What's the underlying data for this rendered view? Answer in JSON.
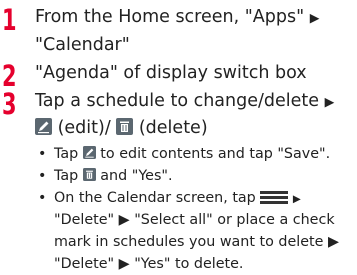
{
  "steps": [
    {
      "number": "1",
      "line1": "From the Home screen, \"Apps\"",
      "arrow": "▶",
      "line2": "\"Calendar\""
    },
    {
      "number": "2",
      "line1": "\"Agenda\" of display switch box"
    },
    {
      "number": "3",
      "line1_a": "Tap a schedule to change/delete",
      "arrow": "▶",
      "edit_text": " (edit)/",
      "delete_text": " (delete)"
    }
  ],
  "bullets": {
    "symbol": "•",
    "b1_a": "Tap",
    "b1_b": "to edit contents and tap \"Save\".",
    "b2_a": "Tap",
    "b2_b": "and \"Yes\".",
    "b3_l1_a": "On the Calendar screen, tap",
    "b3_l1_arrow": "▶",
    "b3_l2": "\"Delete\" ▶ \"Select all\" or place a check",
    "b3_l3": "mark in schedules you want to delete ▶",
    "b3_l4": "\"Delete\" ▶ \"Yes\" to delete."
  },
  "icons": {
    "edit": "pencil-edit-icon",
    "delete": "trash-delete-icon",
    "menu": "menu-icon"
  },
  "colors": {
    "step_number": "#e5002d",
    "text": "#222222"
  }
}
